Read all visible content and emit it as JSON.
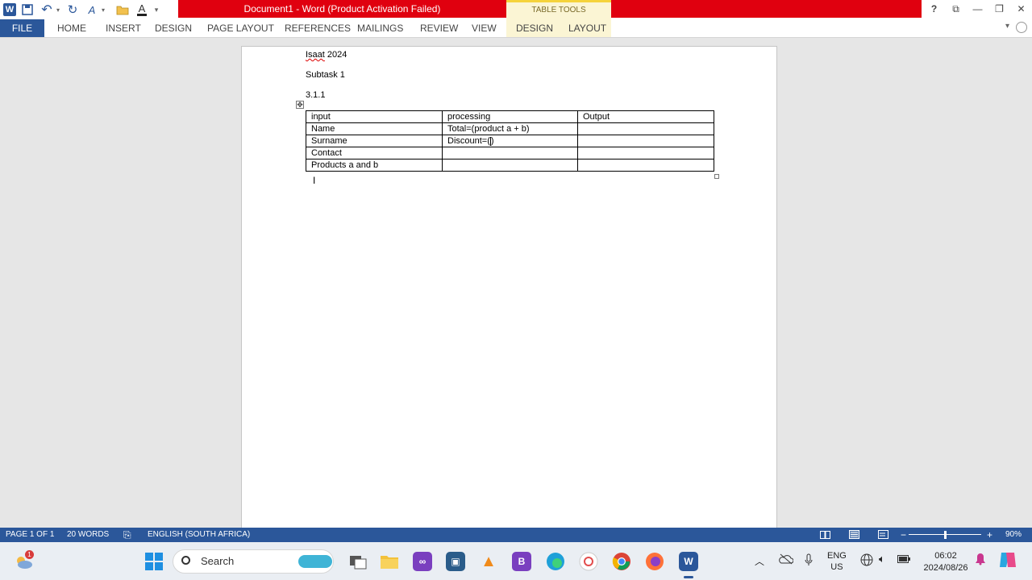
{
  "window": {
    "title": "Document1 -  Word (Product Activation Failed)",
    "context_tab_group": "TABLE TOOLS",
    "help": "?",
    "controls": {
      "options": "⧉",
      "minimize": "—",
      "restore": "❐",
      "close": "✕"
    }
  },
  "quick_access": {
    "word_logo": "W",
    "undo": "↶",
    "redo": "↻",
    "format": "A",
    "open": "▬",
    "font_color": "A",
    "customize": "▾"
  },
  "ribbon": {
    "file": "FILE",
    "tabs": [
      "HOME",
      "INSERT",
      "DESIGN",
      "PAGE LAYOUT",
      "REFERENCES",
      "MAILINGS",
      "REVIEW",
      "VIEW"
    ],
    "context_tabs": [
      "DESIGN",
      "LAYOUT"
    ],
    "options_glyph": "▾"
  },
  "document": {
    "line1_word1": "Isaat",
    "line1_word2": " 2024",
    "line2": "Subtask 1",
    "line3": "3.1.1",
    "table": {
      "headers": [
        "input",
        "processing",
        "Output"
      ],
      "rows": [
        [
          "Name",
          "Total=(product a + b)",
          ""
        ],
        [
          "Surname",
          "Discount=(",
          ""
        ],
        [
          "Contact",
          "",
          ""
        ],
        [
          "Products a and b",
          "",
          ""
        ]
      ],
      "cursor_after": ")"
    },
    "move_handle_glyph": "✥",
    "ibeam_glyph": "I"
  },
  "statusbar": {
    "page": "PAGE 1 OF 1",
    "words": "20 WORDS",
    "proof_glyph": "⎘",
    "language": "ENGLISH (SOUTH AFRICA)",
    "zoom": "90%",
    "zoom_level": 0.5,
    "zoom_minus": "−",
    "zoom_plus": "+"
  },
  "taskbar": {
    "search": "Search",
    "tray_lang": [
      "ENG",
      "US"
    ],
    "time": "06:02",
    "date": "2024/08/26",
    "weather_badge": "1",
    "icons": {
      "word": "W",
      "vs": "∞",
      "app": "▣",
      "vlc": "▲",
      "vsb": "B"
    }
  },
  "colors": {
    "word_blue": "#2b579a",
    "title_red": "#e0000f",
    "table_tools_bg": "#fbf5d4"
  }
}
